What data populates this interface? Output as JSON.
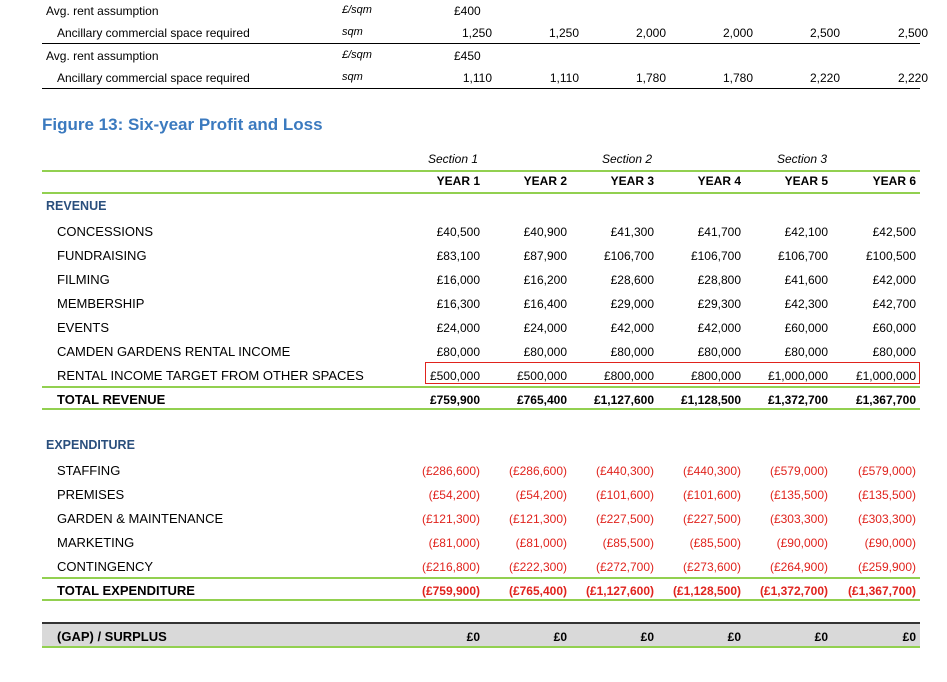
{
  "top_table": {
    "rows": [
      {
        "label": "Avg. rent assumption",
        "unit": "£/sqm",
        "base": "£400",
        "values": [
          "",
          "",
          "",
          "",
          "",
          ""
        ]
      },
      {
        "label": "Ancillary commercial space required",
        "unit": "sqm",
        "base": "",
        "values": [
          "1,250",
          "1,250",
          "2,000",
          "2,000",
          "2,500",
          "2,500"
        ]
      },
      {
        "label": "Avg. rent assumption",
        "unit": "£/sqm",
        "base": "£450",
        "values": [
          "",
          "",
          "",
          "",
          "",
          ""
        ]
      },
      {
        "label": "Ancillary commercial space required",
        "unit": "sqm",
        "base": "",
        "values": [
          "1,110",
          "1,110",
          "1,780",
          "1,780",
          "2,220",
          "2,220"
        ]
      }
    ]
  },
  "figure_title": "Figure 13: Six-year Profit and Loss",
  "sections": [
    "Section 1",
    "Section 2",
    "Section 3"
  ],
  "years": [
    "YEAR 1",
    "YEAR 2",
    "YEAR 3",
    "YEAR 4",
    "YEAR 5",
    "YEAR 6"
  ],
  "revenue": {
    "header": "REVENUE",
    "rows": [
      {
        "label": "CONCESSIONS",
        "values": [
          "£40,500",
          "£40,900",
          "£41,300",
          "£41,700",
          "£42,100",
          "£42,500"
        ]
      },
      {
        "label": "FUNDRAISING",
        "values": [
          "£83,100",
          "£87,900",
          "£106,700",
          "£106,700",
          "£106,700",
          "£100,500"
        ]
      },
      {
        "label": "FILMING",
        "values": [
          "£16,000",
          "£16,200",
          "£28,600",
          "£28,800",
          "£41,600",
          "£42,000"
        ]
      },
      {
        "label": "MEMBERSHIP",
        "values": [
          "£16,300",
          "£16,400",
          "£29,000",
          "£29,300",
          "£42,300",
          "£42,700"
        ]
      },
      {
        "label": "EVENTS",
        "values": [
          "£24,000",
          "£24,000",
          "£42,000",
          "£42,000",
          "£60,000",
          "£60,000"
        ]
      },
      {
        "label": "CAMDEN GARDENS RENTAL INCOME",
        "values": [
          "£80,000",
          "£80,000",
          "£80,000",
          "£80,000",
          "£80,000",
          "£80,000"
        ]
      },
      {
        "label": "RENTAL INCOME TARGET FROM OTHER SPACES",
        "values": [
          "£500,000",
          "£500,000",
          "£800,000",
          "£800,000",
          "£1,000,000",
          "£1,000,000"
        ]
      }
    ],
    "total": {
      "label": "TOTAL REVENUE",
      "values": [
        "£759,900",
        "£765,400",
        "£1,127,600",
        "£1,128,500",
        "£1,372,700",
        "£1,367,700"
      ]
    }
  },
  "expenditure": {
    "header": "EXPENDITURE",
    "rows": [
      {
        "label": "STAFFING",
        "values": [
          "(£286,600)",
          "(£286,600)",
          "(£440,300)",
          "(£440,300)",
          "(£579,000)",
          "(£579,000)"
        ]
      },
      {
        "label": "PREMISES",
        "values": [
          "(£54,200)",
          "(£54,200)",
          "(£101,600)",
          "(£101,600)",
          "(£135,500)",
          "(£135,500)"
        ]
      },
      {
        "label": "GARDEN & MAINTENANCE",
        "values": [
          "(£121,300)",
          "(£121,300)",
          "(£227,500)",
          "(£227,500)",
          "(£303,300)",
          "(£303,300)"
        ]
      },
      {
        "label": "MARKETING",
        "values": [
          "(£81,000)",
          "(£81,000)",
          "(£85,500)",
          "(£85,500)",
          "(£90,000)",
          "(£90,000)"
        ]
      },
      {
        "label": "CONTINGENCY",
        "values": [
          "(£216,800)",
          "(£222,300)",
          "(£272,700)",
          "(£273,600)",
          "(£264,900)",
          "(£259,900)"
        ]
      }
    ],
    "total": {
      "label": "TOTAL EXPENDITURE",
      "values": [
        "(£759,900)",
        "(£765,400)",
        "(£1,127,600)",
        "(£1,128,500)",
        "(£1,372,700)",
        "(£1,367,700)"
      ]
    }
  },
  "gap": {
    "label": "(GAP) / SURPLUS",
    "values": [
      "£0",
      "£0",
      "£0",
      "£0",
      "£0",
      "£0"
    ]
  },
  "colors": {
    "accent_line": "#92d050",
    "title_blue": "#3b7abf",
    "header_navy": "#2a4f7d",
    "negative_red": "#e0231d",
    "highlight_box": "#e0231d",
    "gap_bg": "#d9d9d9"
  }
}
